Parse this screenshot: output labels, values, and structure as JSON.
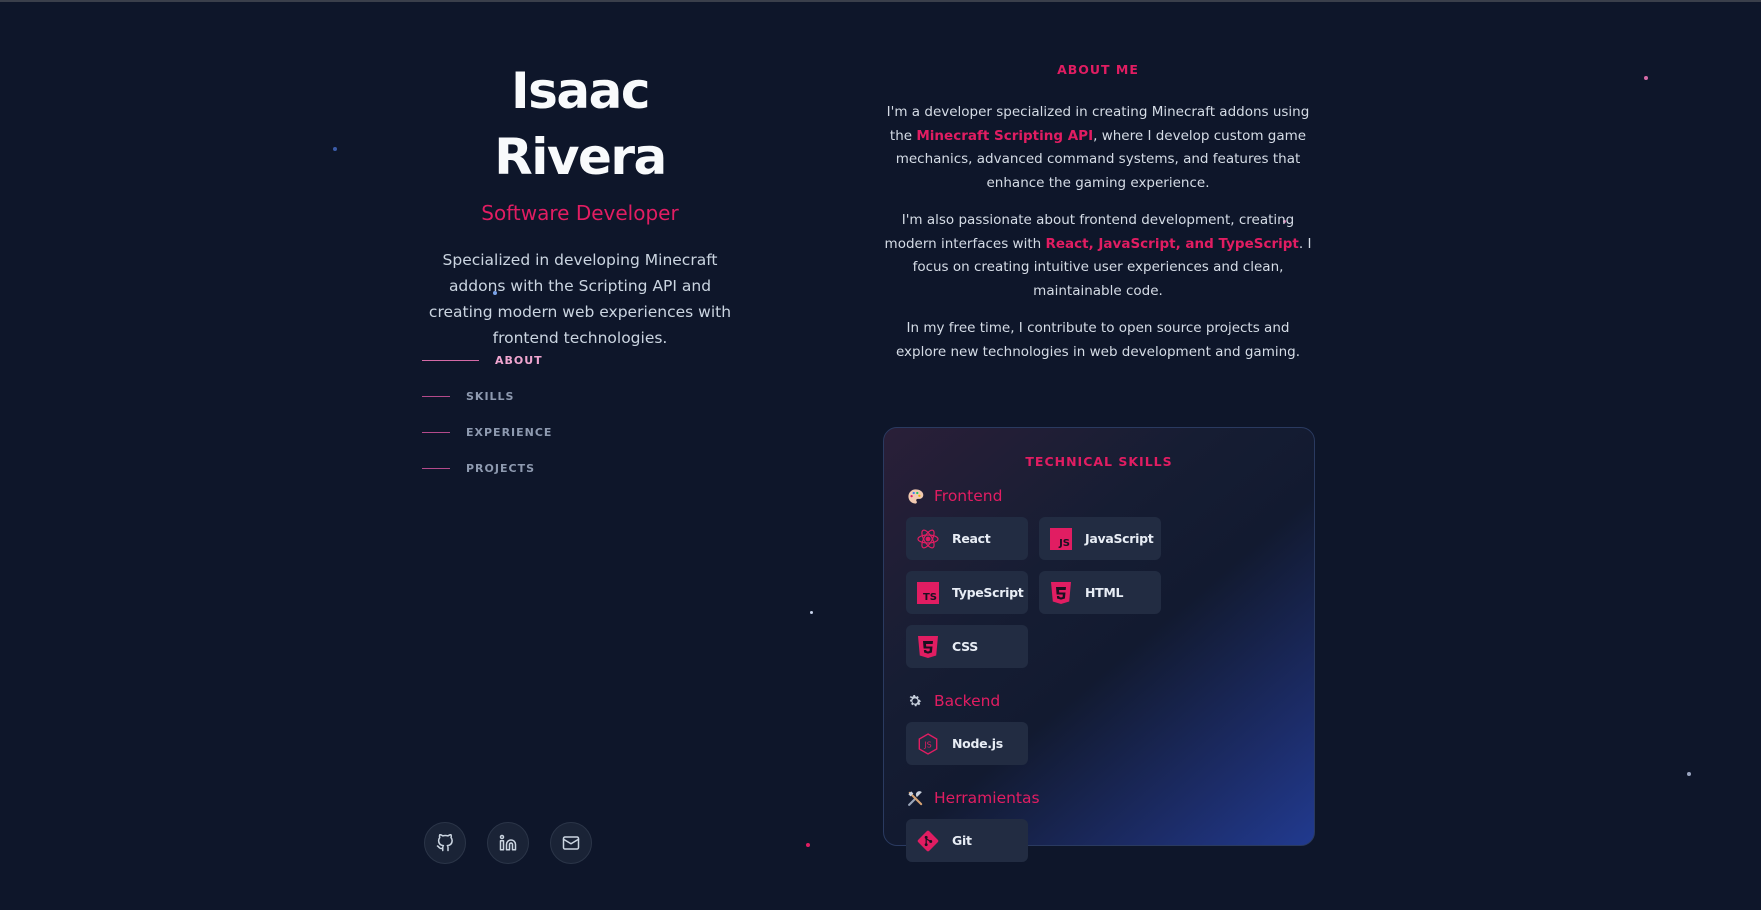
{
  "profile": {
    "name": "Isaac Rivera",
    "role": "Software Developer",
    "intro": "Specialized in developing Minecraft addons with the Scripting API and creating modern web experiences with frontend technologies."
  },
  "nav": {
    "items": [
      {
        "label": "ABOUT",
        "active": true
      },
      {
        "label": "SKILLS",
        "active": false
      },
      {
        "label": "EXPERIENCE",
        "active": false
      },
      {
        "label": "PROJECTS",
        "active": false
      }
    ]
  },
  "socials": {
    "items": [
      {
        "icon": "github-icon"
      },
      {
        "icon": "linkedin-icon"
      },
      {
        "icon": "mail-icon"
      }
    ]
  },
  "about": {
    "heading": "ABOUT ME",
    "p1_a": "I'm a developer specialized in creating Minecraft addons using the ",
    "p1_hl": "Minecraft Scripting API",
    "p1_b": ", where I develop custom game mechanics, advanced command systems, and features that enhance the gaming experience.",
    "p2_a": "I'm also passionate about frontend development, creating modern interfaces with ",
    "p2_hl": "React, JavaScript, and TypeScript",
    "p2_b": ". I focus on creating intuitive user experiences and clean, maintainable code.",
    "p3": "In my free time, I contribute to open source projects and explore new technologies in web development and gaming."
  },
  "skills": {
    "heading": "TECHNICAL SKILLS",
    "categories": [
      {
        "title": "Frontend",
        "icon": "palette-icon",
        "items": [
          "React",
          "JavaScript",
          "TypeScript",
          "HTML",
          "CSS"
        ]
      },
      {
        "title": "Backend",
        "icon": "gear-icon",
        "items": [
          "Node.js"
        ]
      },
      {
        "title": "Herramientas",
        "icon": "tools-icon",
        "items": [
          "Git"
        ]
      }
    ]
  },
  "colors": {
    "accent": "#e11d62",
    "background": "#0e162a",
    "chip": "#222c42"
  }
}
